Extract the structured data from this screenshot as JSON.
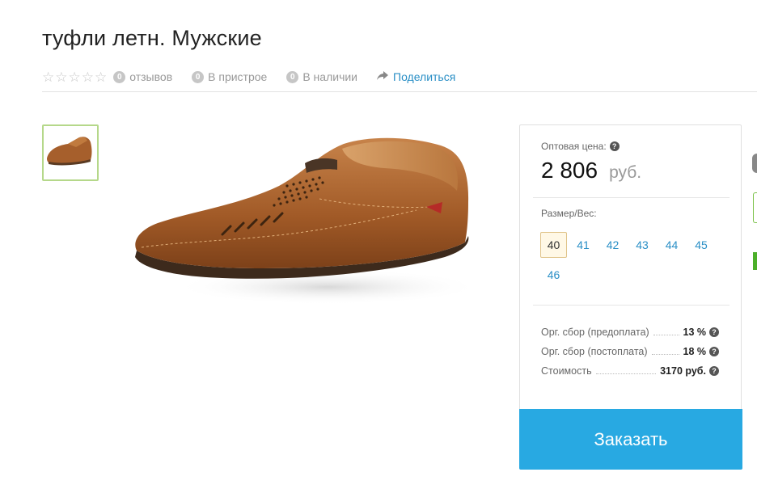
{
  "product": {
    "title": "туфли летн. Мужские"
  },
  "meta": {
    "rating_stars": 0,
    "reviews": {
      "count": "0",
      "label": "отзывов"
    },
    "in_progress": {
      "count": "0",
      "label": "В пристрое"
    },
    "in_stock": {
      "count": "0",
      "label": "В наличии"
    },
    "share_label": "Поделиться"
  },
  "icons": {
    "star": "star-outline-icon",
    "share": "share-arrow-icon",
    "help": "question-circle-icon"
  },
  "panel": {
    "price_label": "Оптовая цена:",
    "price_value": "2 806",
    "price_currency": "руб.",
    "size_label": "Размер/Вес:",
    "sizes": [
      "40",
      "41",
      "42",
      "43",
      "44",
      "45",
      "46"
    ],
    "selected_size": "40",
    "fees": [
      {
        "name": "Орг. сбор (предоплата)",
        "value": "13 %"
      },
      {
        "name": "Орг. сбор (постоплата)",
        "value": "18 %"
      },
      {
        "name": "Стоимость",
        "value": "3170 руб."
      }
    ],
    "order_label": "Заказать"
  },
  "colors": {
    "accent": "#28a9e2",
    "link": "#2a8fc6",
    "thumb_border": "#b5d88a",
    "selected_size_bg": "#fff8e6"
  }
}
